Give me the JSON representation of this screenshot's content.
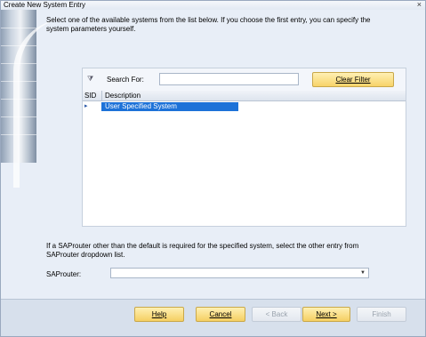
{
  "window": {
    "title": "Create New System Entry",
    "close_glyph": "×"
  },
  "intro_text": "Select one of the available systems from the list below. If you choose the first entry, you can specify the system parameters yourself.",
  "filter": {
    "icon": "filter-icon",
    "search_label": "Search For:",
    "search_value": "",
    "clear_button": "Clear Filter"
  },
  "system_list": {
    "columns": [
      "SID",
      "Description"
    ],
    "rows": [
      {
        "sid": "",
        "description": "User Specified System",
        "selected": true
      }
    ]
  },
  "saprouter": {
    "hint": "If a SAProuter other than the default is required for the specified system, select the other entry from SAProuter dropdown list.",
    "label": "SAProuter:",
    "selected_value": ""
  },
  "buttons": {
    "help": "Help",
    "cancel": "Cancel",
    "back": "< Back",
    "next": "Next >",
    "finish": "Finish"
  },
  "colors": {
    "selection": "#1d72d8",
    "button_active": "#f7d36a",
    "background": "#e8eef7"
  }
}
